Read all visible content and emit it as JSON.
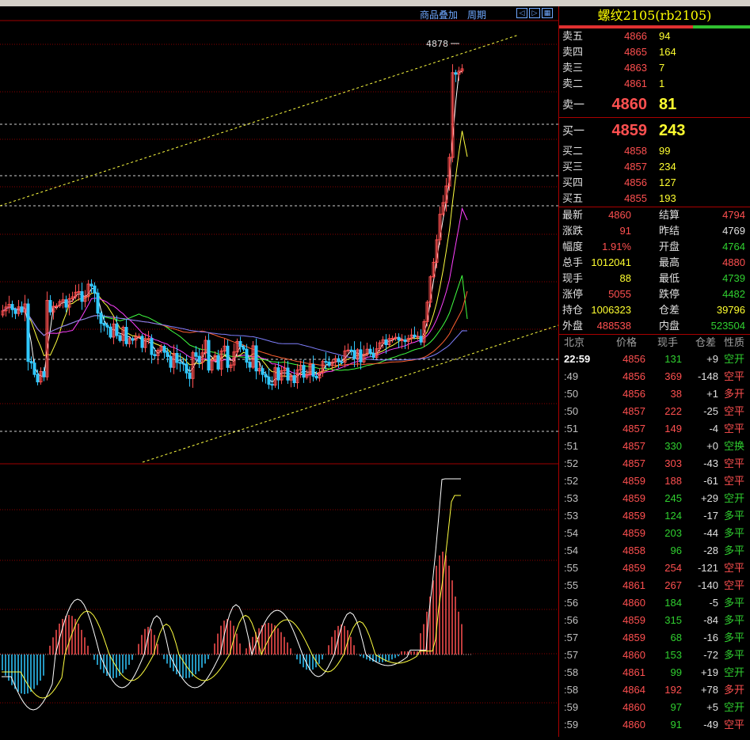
{
  "toolbar": {
    "overlay_label": "商品叠加",
    "period_label": "周期",
    "icons": [
      "arrow-left-icon",
      "arrow-right-icon",
      "grid-icon"
    ]
  },
  "colors": {
    "up": "#ff5050",
    "down": "#30c8ff",
    "green": "#30d030",
    "yellow": "#ffff30",
    "white": "#e0e0e0",
    "grid": "#a00000"
  },
  "chart": {
    "high_marker": "4878"
  },
  "quote": {
    "title": "螺纹2105(rb2105)",
    "sells": [
      {
        "label": "卖五",
        "price": "4866",
        "vol": "94"
      },
      {
        "label": "卖四",
        "price": "4865",
        "vol": "164"
      },
      {
        "label": "卖三",
        "price": "4863",
        "vol": "7"
      },
      {
        "label": "卖二",
        "price": "4861",
        "vol": "1"
      },
      {
        "label": "卖一",
        "price": "4860",
        "vol": "81"
      }
    ],
    "buys": [
      {
        "label": "买一",
        "price": "4859",
        "vol": "243"
      },
      {
        "label": "买二",
        "price": "4858",
        "vol": "99"
      },
      {
        "label": "买三",
        "price": "4857",
        "vol": "234"
      },
      {
        "label": "买四",
        "price": "4856",
        "vol": "127"
      },
      {
        "label": "买五",
        "price": "4855",
        "vol": "193"
      }
    ],
    "stats": [
      {
        "l1": "最新",
        "v1": "4860",
        "c1": "red",
        "l2": "结算",
        "v2": "4794",
        "c2": "red"
      },
      {
        "l1": "涨跌",
        "v1": "91",
        "c1": "red",
        "l2": "昨结",
        "v2": "4769",
        "c2": "white"
      },
      {
        "l1": "幅度",
        "v1": "1.91%",
        "c1": "red",
        "l2": "开盘",
        "v2": "4764",
        "c2": "green"
      },
      {
        "l1": "总手",
        "v1": "1012041",
        "c1": "yellow",
        "l2": "最高",
        "v2": "4880",
        "c2": "red"
      },
      {
        "l1": "现手",
        "v1": "88",
        "c1": "yellow",
        "l2": "最低",
        "v2": "4739",
        "c2": "green"
      },
      {
        "l1": "涨停",
        "v1": "5055",
        "c1": "red",
        "l2": "跌停",
        "v2": "4482",
        "c2": "green"
      },
      {
        "l1": "持仓",
        "v1": "1006323",
        "c1": "yellow",
        "l2": "仓差",
        "v2": "39796",
        "c2": "yellow"
      },
      {
        "l1": "外盘",
        "v1": "488538",
        "c1": "red",
        "l2": "内盘",
        "v2": "523504",
        "c2": "green"
      }
    ],
    "ticks_header": {
      "time": "北京",
      "price": "价格",
      "vol": "现手",
      "oi": "仓差",
      "type": "性质"
    },
    "ticks": [
      {
        "time": "22:59",
        "price": "4856",
        "vol": "131",
        "oi": "+9",
        "type": "空开",
        "pc": "red",
        "vc": "green",
        "tc": "green"
      },
      {
        "time": ":49",
        "price": "4856",
        "vol": "369",
        "oi": "-148",
        "type": "空平",
        "pc": "red",
        "vc": "red",
        "tc": "red"
      },
      {
        "time": ":50",
        "price": "4856",
        "vol": "38",
        "oi": "+1",
        "type": "多开",
        "pc": "red",
        "vc": "red",
        "tc": "red"
      },
      {
        "time": ":50",
        "price": "4857",
        "vol": "222",
        "oi": "-25",
        "type": "空平",
        "pc": "red",
        "vc": "red",
        "tc": "red"
      },
      {
        "time": ":51",
        "price": "4857",
        "vol": "149",
        "oi": "-4",
        "type": "空平",
        "pc": "red",
        "vc": "red",
        "tc": "red"
      },
      {
        "time": ":51",
        "price": "4857",
        "vol": "330",
        "oi": "+0",
        "type": "空换",
        "pc": "red",
        "vc": "green",
        "tc": "green"
      },
      {
        "time": ":52",
        "price": "4857",
        "vol": "303",
        "oi": "-43",
        "type": "空平",
        "pc": "red",
        "vc": "red",
        "tc": "red"
      },
      {
        "time": ":52",
        "price": "4859",
        "vol": "188",
        "oi": "-61",
        "type": "空平",
        "pc": "red",
        "vc": "red",
        "tc": "red"
      },
      {
        "time": ":53",
        "price": "4859",
        "vol": "245",
        "oi": "+29",
        "type": "空开",
        "pc": "red",
        "vc": "green",
        "tc": "green"
      },
      {
        "time": ":53",
        "price": "4859",
        "vol": "124",
        "oi": "-17",
        "type": "多平",
        "pc": "red",
        "vc": "green",
        "tc": "green"
      },
      {
        "time": ":54",
        "price": "4859",
        "vol": "203",
        "oi": "-44",
        "type": "多平",
        "pc": "red",
        "vc": "green",
        "tc": "green"
      },
      {
        "time": ":54",
        "price": "4858",
        "vol": "96",
        "oi": "-28",
        "type": "多平",
        "pc": "red",
        "vc": "green",
        "tc": "green"
      },
      {
        "time": ":55",
        "price": "4859",
        "vol": "254",
        "oi": "-121",
        "type": "空平",
        "pc": "red",
        "vc": "red",
        "tc": "red"
      },
      {
        "time": ":55",
        "price": "4861",
        "vol": "267",
        "oi": "-140",
        "type": "空平",
        "pc": "red",
        "vc": "red",
        "tc": "red"
      },
      {
        "time": ":56",
        "price": "4860",
        "vol": "184",
        "oi": "-5",
        "type": "多平",
        "pc": "red",
        "vc": "green",
        "tc": "green"
      },
      {
        "time": ":56",
        "price": "4859",
        "vol": "315",
        "oi": "-84",
        "type": "多平",
        "pc": "red",
        "vc": "green",
        "tc": "green"
      },
      {
        "time": ":57",
        "price": "4859",
        "vol": "68",
        "oi": "-16",
        "type": "多平",
        "pc": "red",
        "vc": "green",
        "tc": "green"
      },
      {
        "time": ":57",
        "price": "4860",
        "vol": "153",
        "oi": "-72",
        "type": "多平",
        "pc": "red",
        "vc": "green",
        "tc": "green"
      },
      {
        "time": ":58",
        "price": "4861",
        "vol": "99",
        "oi": "+19",
        "type": "空开",
        "pc": "red",
        "vc": "green",
        "tc": "green"
      },
      {
        "time": ":58",
        "price": "4864",
        "vol": "192",
        "oi": "+78",
        "type": "多开",
        "pc": "red",
        "vc": "red",
        "tc": "red"
      },
      {
        "time": ":59",
        "price": "4860",
        "vol": "97",
        "oi": "+5",
        "type": "空开",
        "pc": "red",
        "vc": "green",
        "tc": "green"
      },
      {
        "time": ":59",
        "price": "4860",
        "vol": "91",
        "oi": "-49",
        "type": "空平",
        "pc": "red",
        "vc": "green",
        "tc": "red"
      }
    ]
  }
}
